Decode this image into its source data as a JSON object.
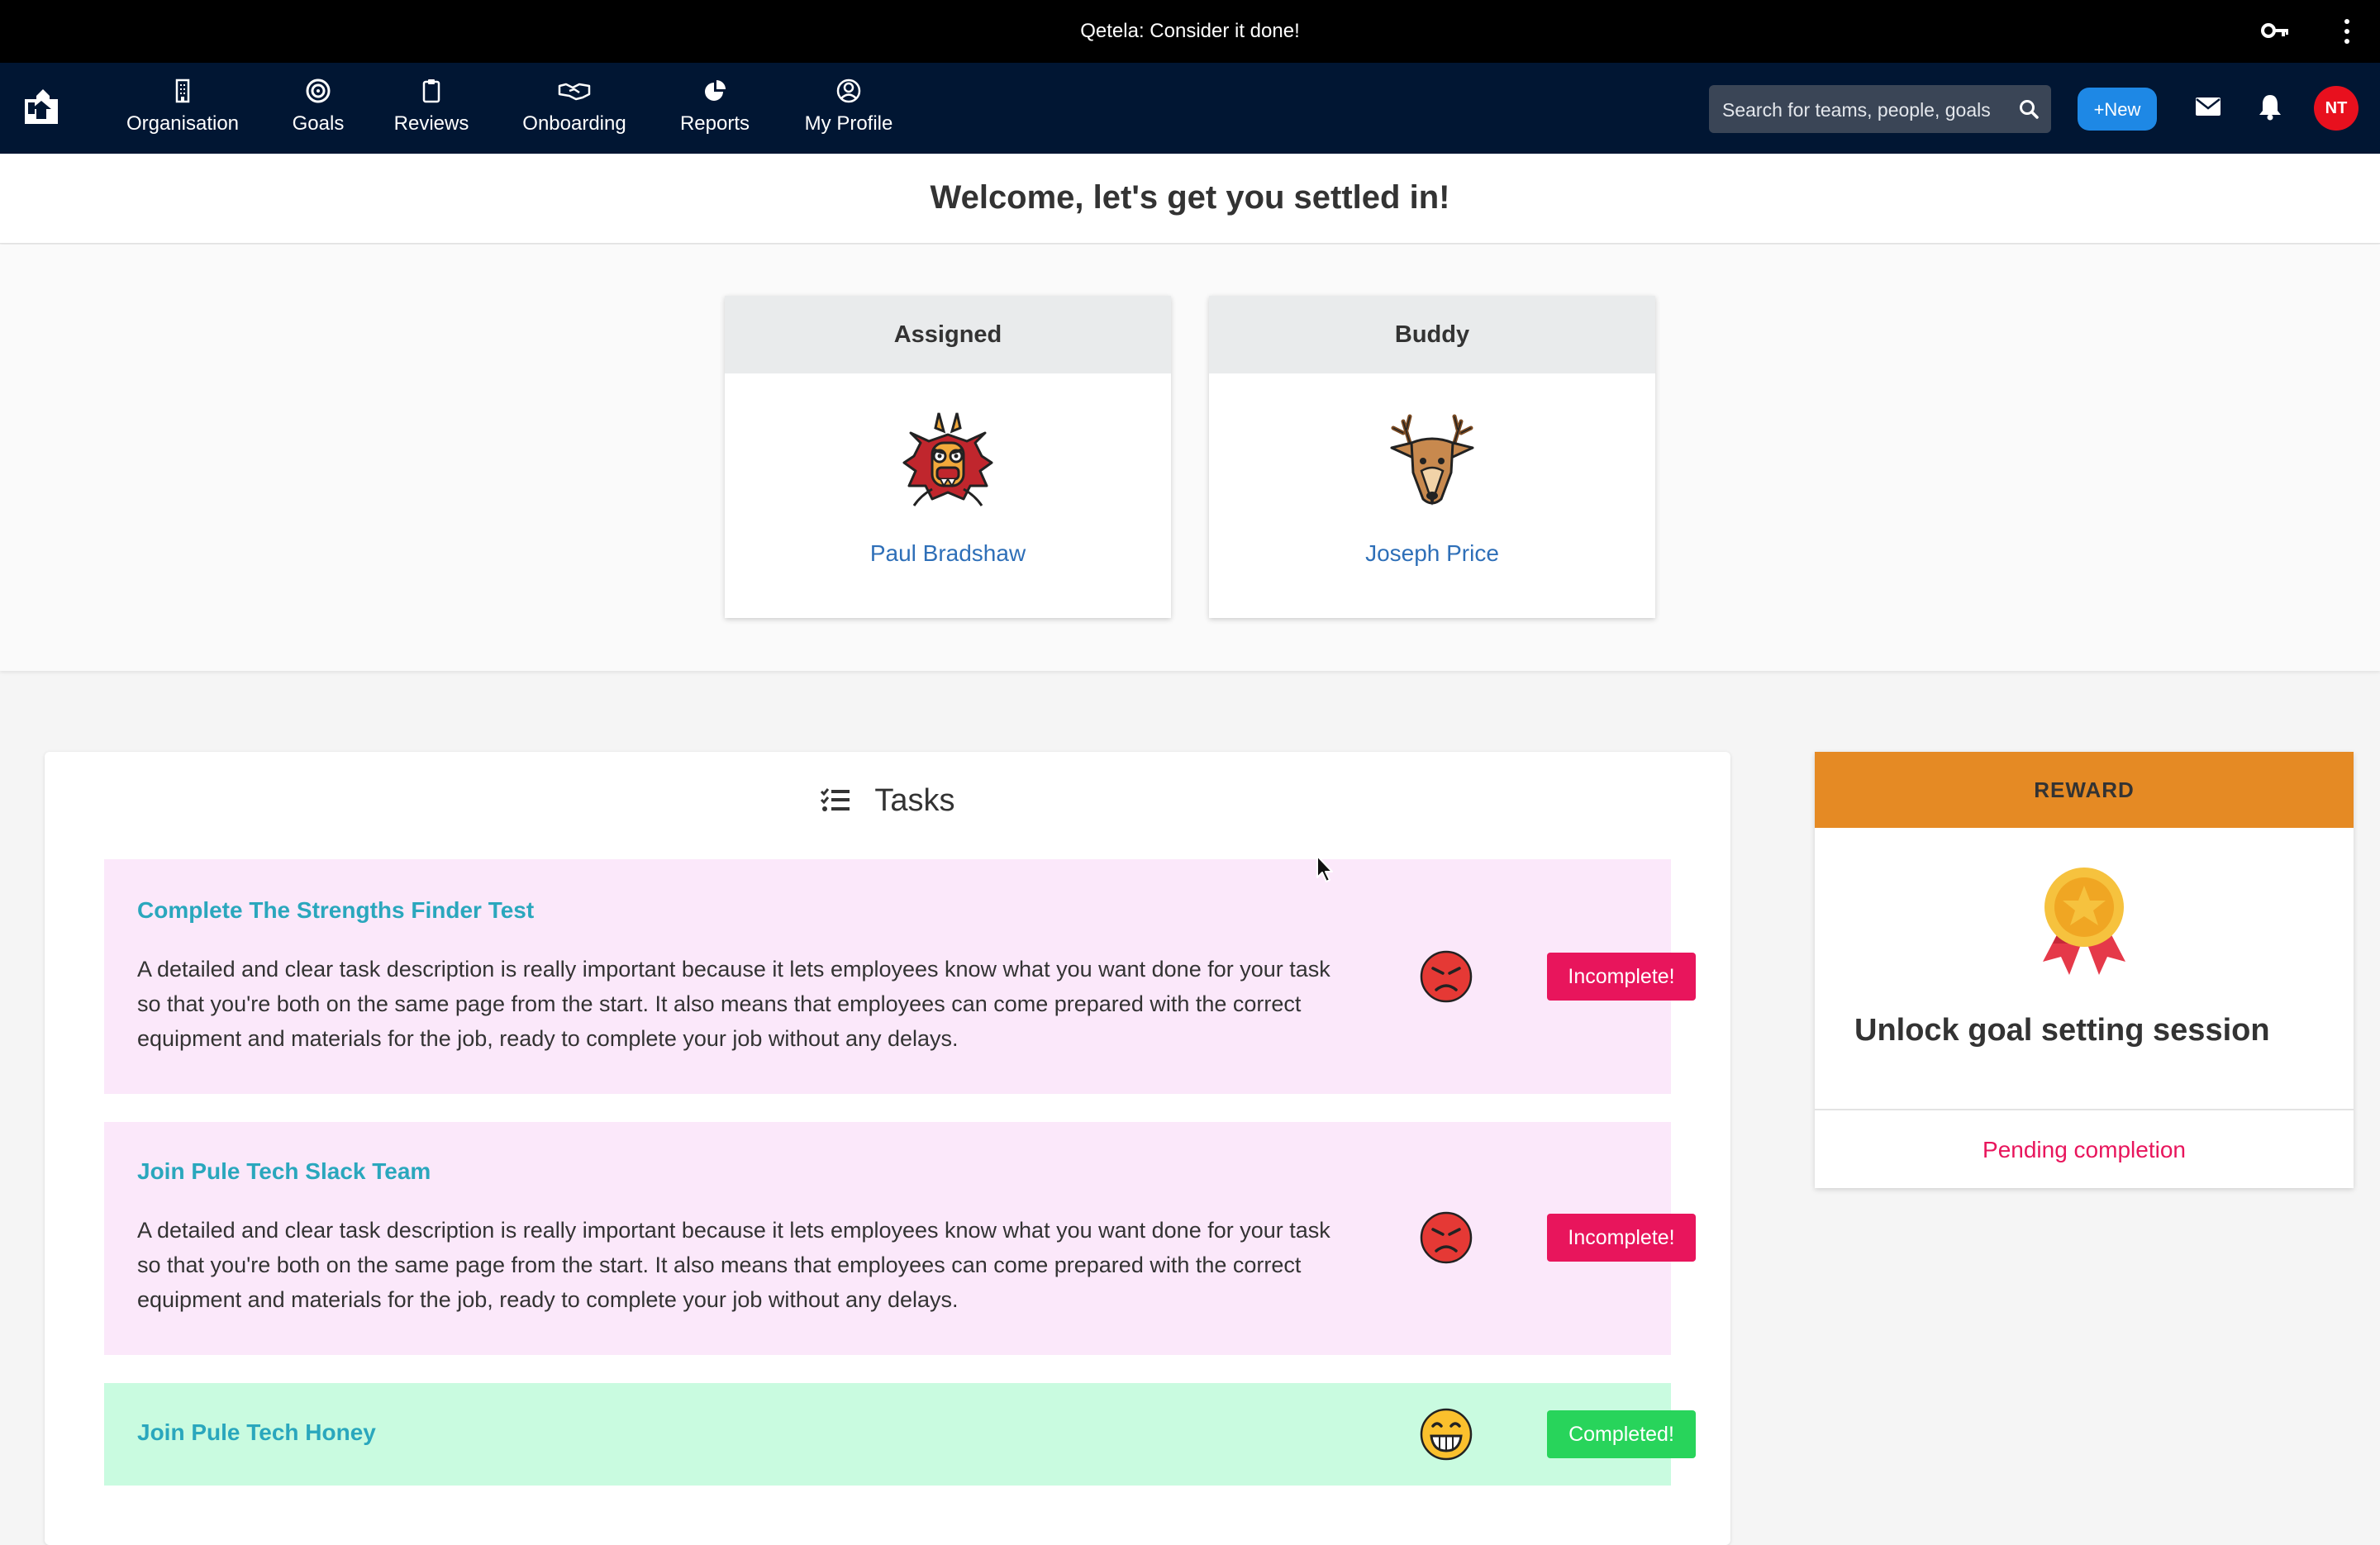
{
  "window": {
    "title": "Qetela: Consider it done!"
  },
  "nav": {
    "items": [
      {
        "label": "Organisation",
        "icon": "building-icon"
      },
      {
        "label": "Goals",
        "icon": "target-icon"
      },
      {
        "label": "Reviews",
        "icon": "clipboard-icon"
      },
      {
        "label": "Onboarding",
        "icon": "handshake-icon"
      },
      {
        "label": "Reports",
        "icon": "pie-chart-icon"
      },
      {
        "label": "My Profile",
        "icon": "user-circle-icon"
      }
    ],
    "search_placeholder": "Search for teams, people, goals",
    "new_label": "+New",
    "avatar_initials": "NT"
  },
  "welcome": {
    "heading": "Welcome, let's get you settled in!"
  },
  "people": {
    "assigned": {
      "header": "Assigned",
      "name": "Paul Bradshaw",
      "icon": "dragon-icon"
    },
    "buddy": {
      "header": "Buddy",
      "name": "Joseph Price",
      "icon": "deer-icon"
    }
  },
  "tasks": {
    "title": "Tasks",
    "items": [
      {
        "title": "Complete The Strengths Finder Test",
        "description": "A detailed and clear task description is really important because it lets employees know what you want done for your task so that you're both on the same page from the start. It also means that employees can come prepared with the correct equipment and materials for the job, ready to complete your job without any delays.",
        "status": "Incomplete!",
        "mood": "angry-face-icon"
      },
      {
        "title": "Join Pule Tech Slack Team",
        "description": "A detailed and clear task description is really important because it lets employees know what you want done for your task so that you're both on the same page from the start. It also means that employees can come prepared with the correct equipment and materials for the job, ready to complete your job without any delays.",
        "status": "Incomplete!",
        "mood": "angry-face-icon"
      },
      {
        "title": "Join Pule Tech Honey",
        "description": "",
        "status": "Completed!",
        "mood": "grinning-face-icon"
      }
    ]
  },
  "reward": {
    "header": "REWARD",
    "title": "Unlock goal setting session",
    "status": "Pending completion",
    "icon": "medal-icon"
  },
  "colors": {
    "navbar": "#011633",
    "incomplete": "#e8155c",
    "completed": "#28d45b",
    "reward_header": "#e58a24",
    "task_pending_bg": "#fbe8fa",
    "task_done_bg": "#c9fbe0",
    "link": "#2e6fb8"
  }
}
